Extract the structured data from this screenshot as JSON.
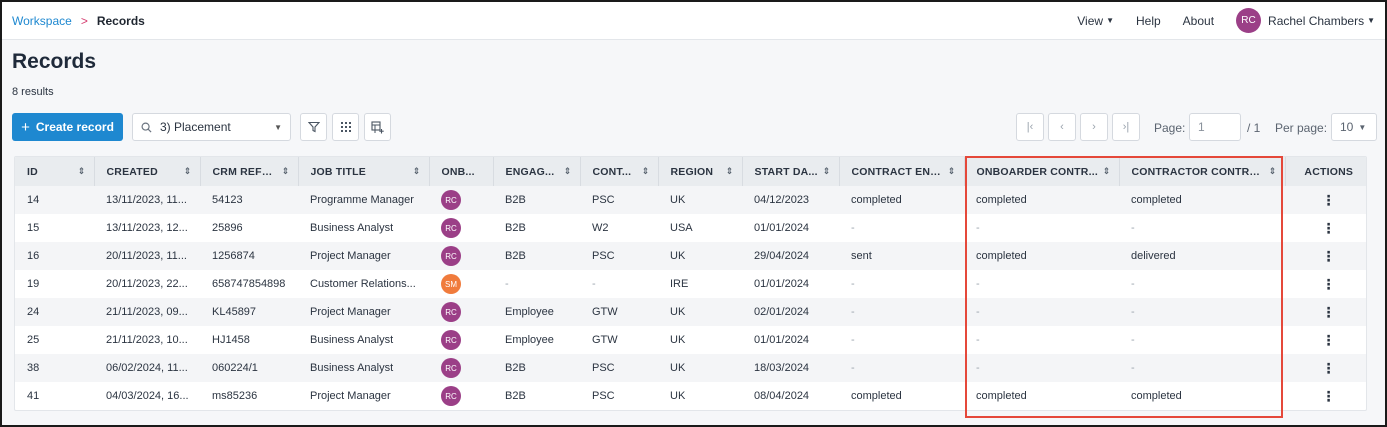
{
  "breadcrumb": {
    "root": "Workspace",
    "separator": ">",
    "current": "Records"
  },
  "top_nav": {
    "view": "View",
    "help": "Help",
    "about": "About"
  },
  "user": {
    "initials": "RC",
    "name": "Rachel Chambers"
  },
  "page": {
    "title": "Records",
    "results": "8 results"
  },
  "toolbar": {
    "create_label": "Create record",
    "view_value": "3) Placement"
  },
  "pager": {
    "page_label": "Page:",
    "page_value": "1",
    "total": "/ 1",
    "per_page_label": "Per page:",
    "per_page_value": "10"
  },
  "colors": {
    "accent": "#1e88d0",
    "avatar_rc": "#9b3f87",
    "avatar_sm": "#f07b3c",
    "highlight": "#e5483a"
  },
  "icons": [
    "search-icon",
    "chevron-down-icon",
    "filter-icon",
    "grid-icon",
    "add-column-icon",
    "first-page-icon",
    "prev-page-icon",
    "next-page-icon",
    "last-page-icon",
    "kebab-icon",
    "sort-icon"
  ],
  "table": {
    "columns": [
      "ID",
      "CREATED",
      "CRM REFE...",
      "JOB TITLE",
      "ONB...",
      "ENGAG...",
      "CONT...",
      "REGION",
      "START DA...",
      "CONTRACT ENV...",
      "ONBOARDER CONTR...",
      "CONTRACTOR CONTRA...",
      "ACTIONS"
    ],
    "rows": [
      {
        "id": "14",
        "created": "13/11/2023, 11...",
        "crm": "54123",
        "job": "Programme Manager",
        "onb": "RC",
        "engag": "B2B",
        "cont": "PSC",
        "region": "UK",
        "start": "04/12/2023",
        "env": "completed",
        "onb_contract": "completed",
        "ctr_contract": "completed"
      },
      {
        "id": "15",
        "created": "13/11/2023, 12...",
        "crm": "25896",
        "job": "Business Analyst",
        "onb": "RC",
        "engag": "B2B",
        "cont": "W2",
        "region": "USA",
        "start": "01/01/2024",
        "env": "-",
        "onb_contract": "-",
        "ctr_contract": "-"
      },
      {
        "id": "16",
        "created": "20/11/2023, 11...",
        "crm": "1256874",
        "job": "Project Manager",
        "onb": "RC",
        "engag": "B2B",
        "cont": "PSC",
        "region": "UK",
        "start": "29/04/2024",
        "env": "sent",
        "onb_contract": "completed",
        "ctr_contract": "delivered"
      },
      {
        "id": "19",
        "created": "20/11/2023, 22...",
        "crm": "658747854898",
        "job": "Customer Relations...",
        "onb": "SM",
        "engag": "-",
        "cont": "-",
        "region": "IRE",
        "start": "01/01/2024",
        "env": "-",
        "onb_contract": "-",
        "ctr_contract": "-"
      },
      {
        "id": "24",
        "created": "21/11/2023, 09...",
        "crm": "KL45897",
        "job": "Project Manager",
        "onb": "RC",
        "engag": "Employee",
        "cont": "GTW",
        "region": "UK",
        "start": "02/01/2024",
        "env": "-",
        "onb_contract": "-",
        "ctr_contract": "-"
      },
      {
        "id": "25",
        "created": "21/11/2023, 10...",
        "crm": "HJ1458",
        "job": "Business Analyst",
        "onb": "RC",
        "engag": "Employee",
        "cont": "GTW",
        "region": "UK",
        "start": "01/01/2024",
        "env": "-",
        "onb_contract": "-",
        "ctr_contract": "-"
      },
      {
        "id": "38",
        "created": "06/02/2024, 11...",
        "crm": "060224/1",
        "job": "Business Analyst",
        "onb": "RC",
        "engag": "B2B",
        "cont": "PSC",
        "region": "UK",
        "start": "18/03/2024",
        "env": "-",
        "onb_contract": "-",
        "ctr_contract": "-"
      },
      {
        "id": "41",
        "created": "04/03/2024, 16...",
        "crm": "ms85236",
        "job": "Project Manager",
        "onb": "RC",
        "engag": "B2B",
        "cont": "PSC",
        "region": "UK",
        "start": "08/04/2024",
        "env": "completed",
        "onb_contract": "completed",
        "ctr_contract": "completed"
      }
    ]
  }
}
